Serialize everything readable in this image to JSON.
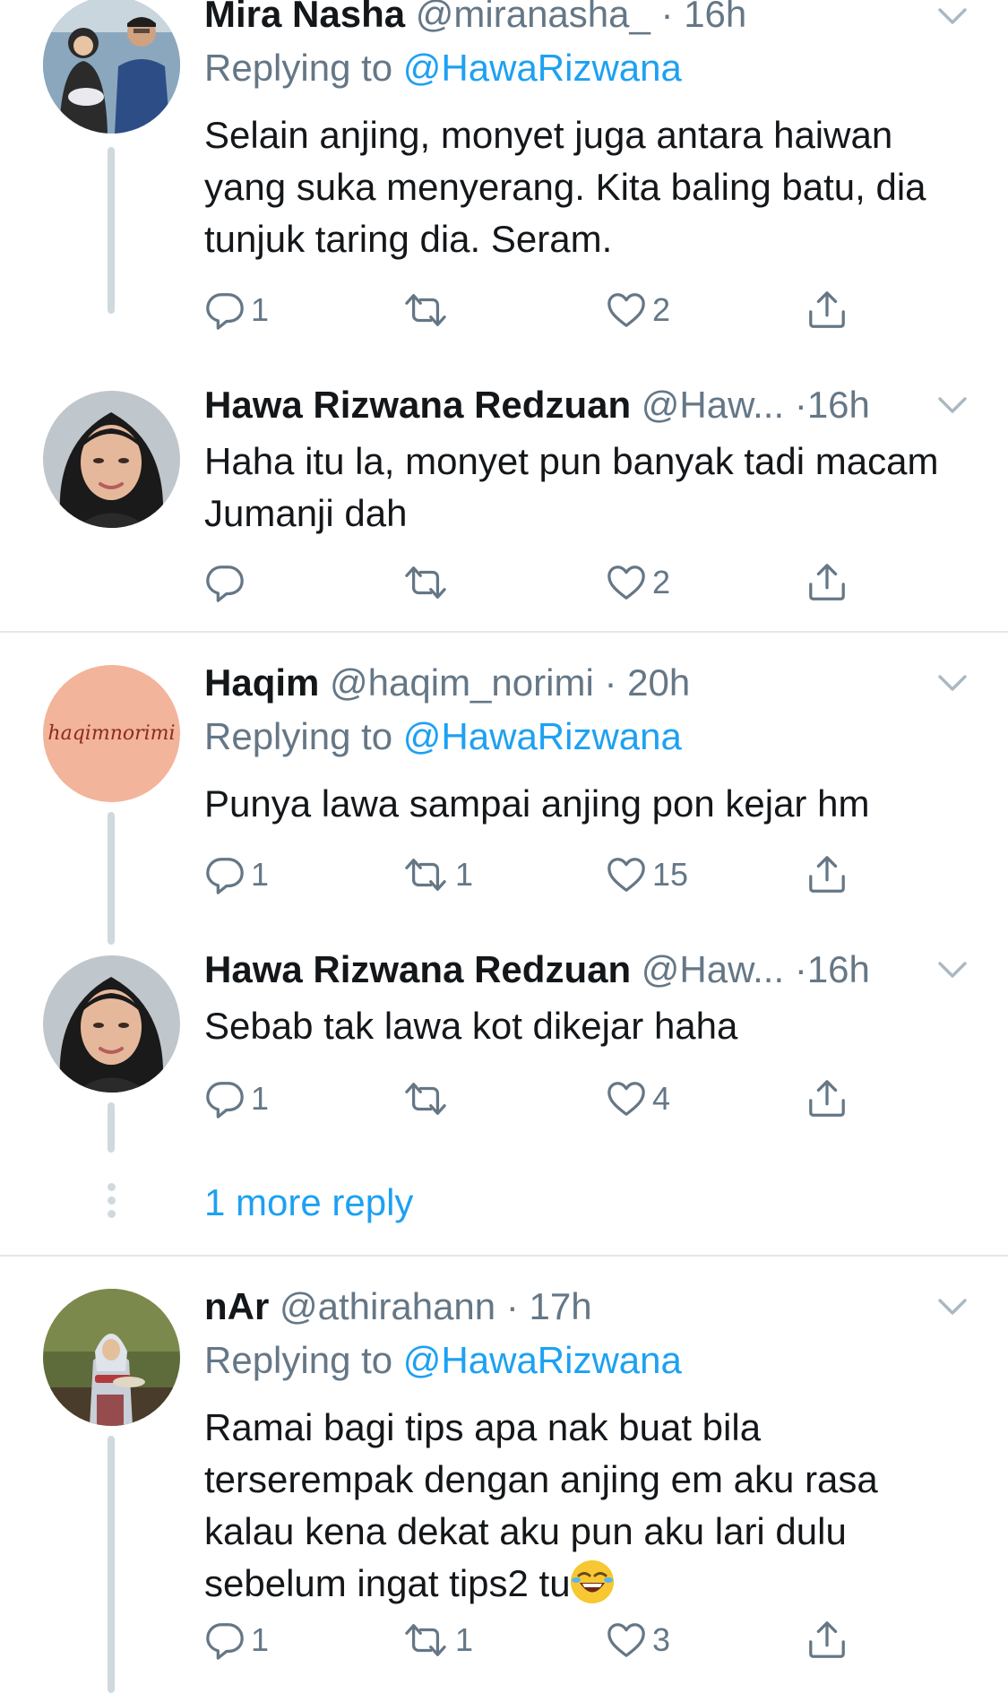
{
  "colors": {
    "accent": "#1da1f2",
    "muted": "#657786",
    "text": "#14171a",
    "line": "#cfd9de"
  },
  "tweets": [
    {
      "name": "Mira Nasha",
      "handle": "@miranasha_",
      "dot": "·",
      "time": "16h",
      "reply_prefix": "Replying to ",
      "reply_to": "@HawaRizwana",
      "text": "Selain anjing, monyet juga antara haiwan yang suka menyerang. Kita baling batu, dia tunjuk taring dia. Seram.",
      "counts": {
        "reply": "1",
        "retweet": "",
        "like": "2"
      }
    },
    {
      "name": "Hawa Rizwana Redzuan",
      "handle": "@Haw...",
      "dot": "·",
      "time": "16h",
      "text": "Haha itu la, monyet pun banyak tadi macam Jumanji dah",
      "counts": {
        "reply": "",
        "retweet": "",
        "like": "2"
      }
    },
    {
      "name": "Haqim",
      "handle": "@haqim_norimi",
      "dot": "·",
      "time": "20h",
      "avatar_text": "haqimnorimi",
      "reply_prefix": "Replying to ",
      "reply_to": "@HawaRizwana",
      "text": "Punya lawa sampai anjing pon kejar hm",
      "counts": {
        "reply": "1",
        "retweet": "1",
        "like": "15"
      }
    },
    {
      "name": "Hawa Rizwana Redzuan",
      "handle": "@Haw...",
      "dot": "·",
      "time": "16h",
      "text": "Sebab tak lawa kot dikejar haha",
      "counts": {
        "reply": "1",
        "retweet": "",
        "like": "4"
      }
    },
    {
      "name": "nAr",
      "handle": "@athirahann",
      "dot": "·",
      "time": "17h",
      "reply_prefix": "Replying to ",
      "reply_to": "@HawaRizwana",
      "text": "Ramai bagi tips apa nak buat bila terserempak dengan anjing em aku rasa kalau kena dekat aku pun aku lari dulu sebelum ingat tips2 tu",
      "counts": {
        "reply": "1",
        "retweet": "1",
        "like": "3"
      }
    }
  ],
  "more_replies": "1 more reply",
  "icons": [
    "reply-icon",
    "retweet-icon",
    "like-icon",
    "share-icon",
    "chevron-down-icon",
    "laughing-emoji-icon"
  ]
}
